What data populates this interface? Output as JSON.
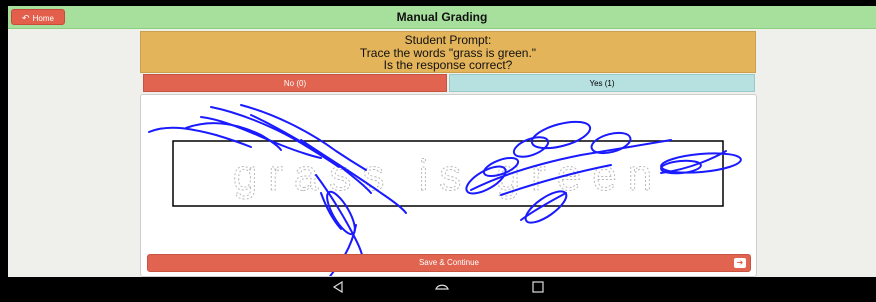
{
  "header": {
    "home_label": "Home",
    "title": "Manual Grading"
  },
  "prompt": {
    "line1": "Student Prompt:",
    "line2": "Trace the words \"grass is green.\"",
    "line3": "Is the response correct?"
  },
  "choices": {
    "no_label": "No (0)",
    "yes_label": "Yes (1)"
  },
  "trace_text": "grass is green",
  "save_label": "Save & Continue",
  "icons": {
    "home": "back-arrow-icon",
    "save": "right-arrow-icon",
    "nav": [
      "back-icon",
      "home-icon",
      "recents-icon"
    ]
  },
  "colors": {
    "header": "#a7e09c",
    "prompt": "#e4b45b",
    "no": "#e06450",
    "yes": "#b6e1e0",
    "ink": "#1a1aff"
  }
}
